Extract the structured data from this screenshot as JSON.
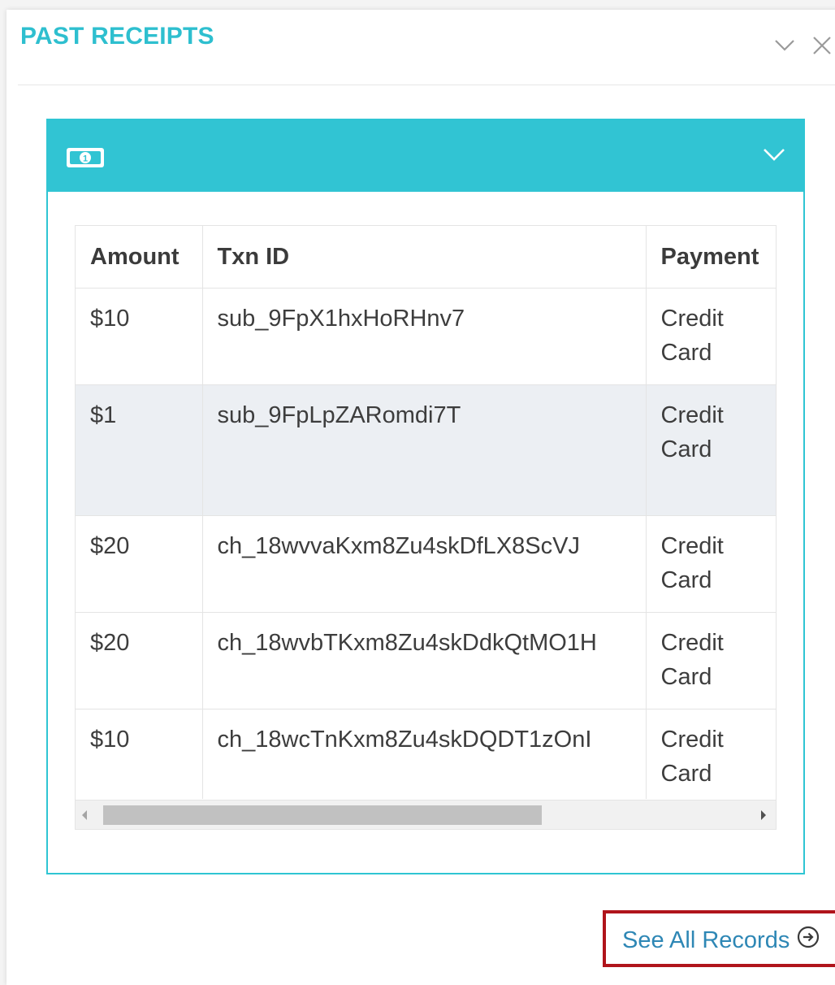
{
  "panel": {
    "title": "PAST RECEIPTS",
    "collapse_icon": "chevron-down-icon",
    "close_icon": "close-icon"
  },
  "widget": {
    "icon": "money-bill-icon",
    "toggle_icon": "chevron-down-icon",
    "accent_color": "#31c4d3"
  },
  "table": {
    "columns": [
      "Amount",
      "Txn ID",
      "Payment"
    ],
    "rows": [
      {
        "amount": "$10",
        "txn_id": "sub_9FpX1hxHoRHnv7",
        "payment_line1": "Credit",
        "payment_line2": "Card"
      },
      {
        "amount": "$1",
        "txn_id": "sub_9FpLpZARomdi7T",
        "payment_line1": "Credit",
        "payment_line2": "Card"
      },
      {
        "amount": "$20",
        "txn_id": "ch_18wvvaKxm8Zu4skDfLX8ScVJ",
        "payment_line1": "Credit",
        "payment_line2": "Card"
      },
      {
        "amount": "$20",
        "txn_id": "ch_18wvbTKxm8Zu4skDdkQtMO1H",
        "payment_line1": "Credit",
        "payment_line2": "Card"
      },
      {
        "amount": "$10",
        "txn_id": "ch_18wcTnKxm8Zu4skDQDT1zOnI",
        "payment_line1": "Credit",
        "payment_line2": "Card"
      }
    ]
  },
  "footer": {
    "see_all_label": "See All Records",
    "see_all_icon": "arrow-circle-right-icon",
    "highlight_color": "#b0141b"
  }
}
